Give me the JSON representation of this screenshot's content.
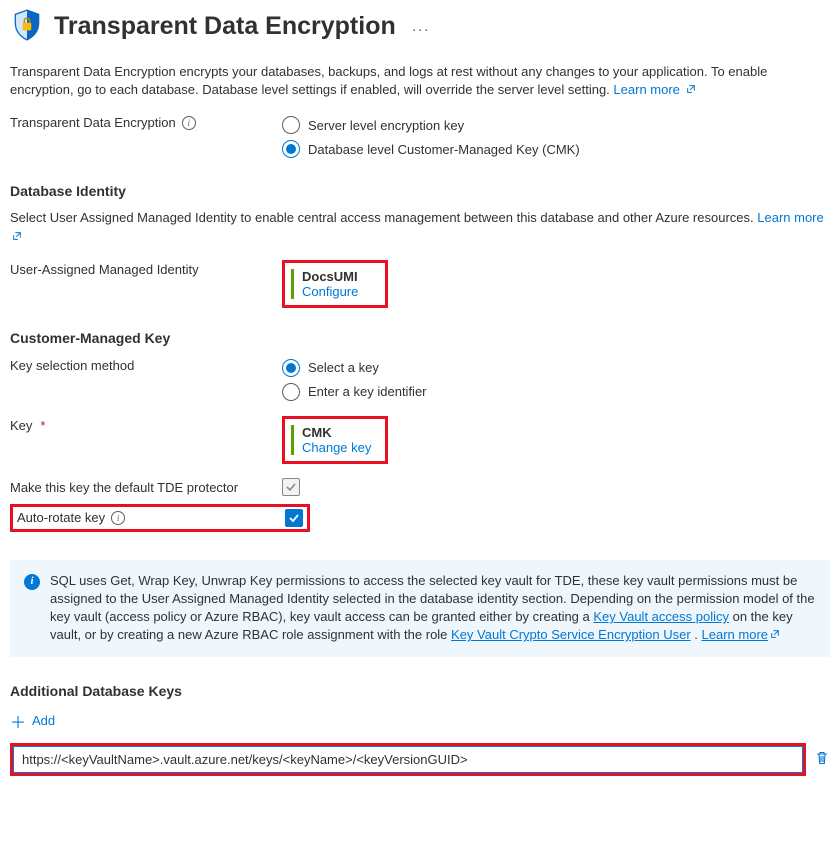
{
  "header": {
    "title": "Transparent Data Encryption"
  },
  "intro": {
    "text": "Transparent Data Encryption encrypts your databases, backups, and logs at rest without any changes to your application. To enable encryption, go to each database. Database level settings if enabled, will override the server level setting.",
    "learn_more": "Learn more"
  },
  "tde_option": {
    "label": "Transparent Data Encryption",
    "radio_server": "Server level encryption key",
    "radio_db": "Database level Customer-Managed Key (CMK)"
  },
  "db_identity": {
    "heading": "Database Identity",
    "desc": "Select User Assigned Managed Identity to enable central access management between this database and other Azure resources.",
    "learn_more": "Learn more",
    "umi_label": "User-Assigned Managed Identity",
    "umi_value": "DocsUMI",
    "umi_configure": "Configure"
  },
  "cmk": {
    "heading": "Customer-Managed Key",
    "selection_label": "Key selection method",
    "radio_select": "Select a key",
    "radio_identifier": "Enter a key identifier",
    "key_label": "Key",
    "key_value": "CMK",
    "change_key": "Change key",
    "default_protector_label": "Make this key the default TDE protector",
    "auto_rotate_label": "Auto-rotate key"
  },
  "info_panel": {
    "text_pre": "SQL uses Get, Wrap Key, Unwrap Key permissions to access the selected key vault for TDE, these key vault permissions must be assigned to the User Assigned Managed Identity selected in the database identity section. Depending on the permission model of the key vault (access policy or Azure RBAC), key vault access can be granted either by creating a ",
    "link1": "Key Vault access policy",
    "text_mid": " on the key vault, or by creating a new Azure RBAC role assignment with the role ",
    "link2": "Key Vault Crypto Service Encryption User",
    "text_end": ". ",
    "learn_more": "Learn more"
  },
  "additional_keys": {
    "heading": "Additional Database Keys",
    "add": "Add",
    "input_value": "https://<keyVaultName>.vault.azure.net/keys/<keyName>/<keyVersionGUID>"
  }
}
